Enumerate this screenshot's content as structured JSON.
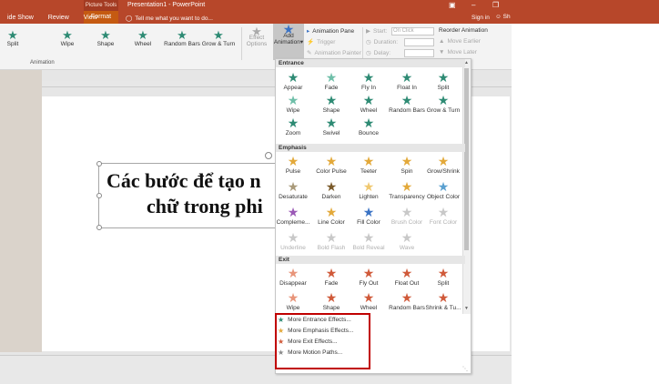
{
  "titlebar": {
    "doc_title": "Presentation1 - PowerPoint",
    "picture_tools": "Picture Tools",
    "tabs": [
      "ide Show",
      "Review",
      "View"
    ],
    "format_tab": "Format",
    "tell_me": "Tell me what you want to do...",
    "sign_in": "Sign in",
    "share": "Sh"
  },
  "ribbon": {
    "animations": [
      {
        "label": "Split",
        "icon": "split-star-icon"
      },
      {
        "label": "Wipe",
        "icon": "wipe-star-icon"
      },
      {
        "label": "Shape",
        "icon": "shape-star-icon"
      },
      {
        "label": "Wheel",
        "icon": "wheel-star-icon"
      },
      {
        "label": "Random Bars",
        "icon": "random-bars-star-icon"
      },
      {
        "label": "Grow & Turn",
        "icon": "grow-turn-star-icon"
      }
    ],
    "effect_options": "Effect Options",
    "add_animation_l1": "Add",
    "add_animation_l2": "Animation",
    "animation_pane": "Animation Pane",
    "trigger": "Trigger",
    "animation_painter": "Animation Painter",
    "start_label": "Start:",
    "start_value": "On Click",
    "duration_label": "Duration:",
    "delay_label": "Delay:",
    "reorder": "Reorder Animation",
    "move_earlier": "Move Earlier",
    "move_later": "Move Later",
    "group_label": "Animation"
  },
  "slide": {
    "line1": "Các bước để tạo n",
    "line2": "chữ trong phi"
  },
  "gallery": {
    "sections": {
      "entrance": "Entrance",
      "emphasis": "Emphasis",
      "exit": "Exit"
    },
    "entrance": [
      {
        "label": "Appear",
        "color": "#2e8b74"
      },
      {
        "label": "Fade",
        "color": "#6fbfa9"
      },
      {
        "label": "Fly In",
        "color": "#2e8b74"
      },
      {
        "label": "Float In",
        "color": "#2e8b74"
      },
      {
        "label": "Split",
        "color": "#2e8b74"
      },
      {
        "label": "Wipe",
        "color": "#6fbfa9"
      },
      {
        "label": "Shape",
        "color": "#2e8b74"
      },
      {
        "label": "Wheel",
        "color": "#2e8b74"
      },
      {
        "label": "Random Bars",
        "color": "#2e8b74"
      },
      {
        "label": "Grow & Turn",
        "color": "#2e8b74"
      },
      {
        "label": "Zoom",
        "color": "#2e8b74"
      },
      {
        "label": "Swivel",
        "color": "#2e8b74"
      },
      {
        "label": "Bounce",
        "color": "#2e8b74"
      }
    ],
    "emphasis": [
      {
        "label": "Pulse",
        "color": "#e3a93a",
        "dim": false
      },
      {
        "label": "Color Pulse",
        "color": "#e3a93a",
        "dim": false
      },
      {
        "label": "Teeter",
        "color": "#e3a93a",
        "dim": false
      },
      {
        "label": "Spin",
        "color": "#e3a93a",
        "dim": false
      },
      {
        "label": "Grow/Shrink",
        "color": "#e3a93a",
        "dim": false
      },
      {
        "label": "Desaturate",
        "color": "#a99a7a",
        "dim": false
      },
      {
        "label": "Darken",
        "color": "#7a5a2a",
        "dim": false
      },
      {
        "label": "Lighten",
        "color": "#f0c870",
        "dim": false
      },
      {
        "label": "Transparency",
        "color": "#e3a93a",
        "dim": false
      },
      {
        "label": "Object Color",
        "color": "#5aa0d0",
        "dim": false
      },
      {
        "label": "Compleme...",
        "color": "#9b59b6",
        "dim": false
      },
      {
        "label": "Line Color",
        "color": "#e3a93a",
        "dim": false
      },
      {
        "label": "Fill Color",
        "color": "#3b73c4",
        "dim": false
      },
      {
        "label": "Brush Color",
        "color": "#c8c8c8",
        "dim": true
      },
      {
        "label": "Font Color",
        "color": "#c8c8c8",
        "dim": true
      },
      {
        "label": "Underline",
        "color": "#c8c8c8",
        "dim": true
      },
      {
        "label": "Bold Flash",
        "color": "#c8c8c8",
        "dim": true
      },
      {
        "label": "Bold Reveal",
        "color": "#c8c8c8",
        "dim": true
      },
      {
        "label": "Wave",
        "color": "#c8c8c8",
        "dim": true
      }
    ],
    "exit": [
      {
        "label": "Disappear",
        "color": "#e8957a"
      },
      {
        "label": "Fade",
        "color": "#d05a3a"
      },
      {
        "label": "Fly Out",
        "color": "#d05a3a"
      },
      {
        "label": "Float Out",
        "color": "#d05a3a"
      },
      {
        "label": "Split",
        "color": "#d05a3a"
      },
      {
        "label": "Wipe",
        "color": "#e8957a"
      },
      {
        "label": "Shape",
        "color": "#d05a3a"
      },
      {
        "label": "Wheel",
        "color": "#d05a3a"
      },
      {
        "label": "Random Bars",
        "color": "#d05a3a"
      },
      {
        "label": "Shrink & Tu...",
        "color": "#d05a3a"
      }
    ],
    "more": [
      {
        "label": "More Entrance Effects...",
        "color": "#2e8b74"
      },
      {
        "label": "More Emphasis Effects...",
        "color": "#e3a93a"
      },
      {
        "label": "More Exit Effects...",
        "color": "#d05a3a"
      },
      {
        "label": "More Motion Paths...",
        "color": "#888888"
      }
    ]
  },
  "colors": {
    "titlebar": "#b7472a",
    "highlight_box": "#c00000"
  }
}
